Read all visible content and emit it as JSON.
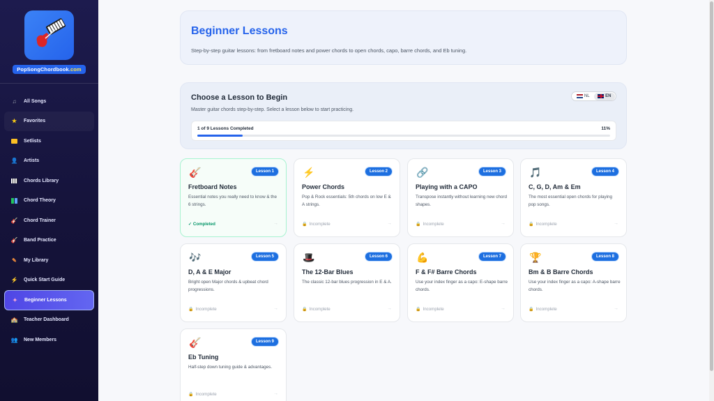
{
  "brand": {
    "name_part1": "PopSongChordbook",
    "name_part2": ".com"
  },
  "nav": [
    {
      "label": "All Songs",
      "icon": "music-note-icon"
    },
    {
      "label": "Favorites",
      "icon": "star-icon"
    },
    {
      "label": "Setlists",
      "icon": "folder-icon"
    },
    {
      "label": "Artists",
      "icon": "person-icon"
    },
    {
      "label": "Chords Library",
      "icon": "piano-icon"
    },
    {
      "label": "Chord Theory",
      "icon": "books-icon"
    },
    {
      "label": "Chord Trainer",
      "icon": "guitar-icon"
    },
    {
      "label": "Band Practice",
      "icon": "guitar-icon"
    },
    {
      "label": "My Library",
      "icon": "pencil-icon"
    },
    {
      "label": "Quick Start Guide",
      "icon": "lightning-icon"
    },
    {
      "label": "Beginner Lessons",
      "icon": "sparkle-icon"
    },
    {
      "label": "Teacher Dashboard",
      "icon": "school-icon"
    },
    {
      "label": "New Members",
      "icon": "people-icon"
    }
  ],
  "hero": {
    "title": "Beginner Lessons",
    "subtitle": "Step-by-step guitar lessons: from fretboard notes and power chords to open chords, capo, barre chords, and Eb tuning."
  },
  "choose": {
    "title": "Choose a Lesson to Begin",
    "subtitle": "Master guitar chords step-by-step. Select a lesson below to start practicing.",
    "lang_nl": "NL",
    "lang_en": "EN",
    "progress_label": "1 of 9 Lessons Completed",
    "progress_pct": "11%",
    "progress_value": 11
  },
  "lessons": [
    {
      "badge": "Lesson 1",
      "title": "Fretboard Notes",
      "desc": "Essential notes you really need to know & the 6 strings.",
      "status": "✓ Completed",
      "icon": "guitar-icon",
      "glyph": "🎸",
      "done": true
    },
    {
      "badge": "Lesson 2",
      "title": "Power Chords",
      "desc": "Pop & Rock essentials: 5th chords on low E & A strings.",
      "status": "Incomplete",
      "icon": "lightning-icon",
      "glyph": "⚡"
    },
    {
      "badge": "Lesson 3",
      "title": "Playing with a CAPO",
      "desc": "Transpose instantly without learning new chord shapes.",
      "status": "Incomplete",
      "icon": "link-icon",
      "glyph": "🔗"
    },
    {
      "badge": "Lesson 4",
      "title": "C, G, D, Am & Em",
      "desc": "The most essential open chords for playing pop songs.",
      "status": "Incomplete",
      "icon": "music-note-icon",
      "glyph": "🎵"
    },
    {
      "badge": "Lesson 5",
      "title": "D, A & E Major",
      "desc": "Bright open Major chords & upbeat chord progressions.",
      "status": "Incomplete",
      "icon": "music-notes-icon",
      "glyph": "🎶"
    },
    {
      "badge": "Lesson 6",
      "title": "The 12-Bar Blues",
      "desc": "The classic 12-bar blues progression in E & A.",
      "status": "Incomplete",
      "icon": "top-hat-icon",
      "glyph": "🎩"
    },
    {
      "badge": "Lesson 7",
      "title": "F & F# Barre Chords",
      "desc": "Use your index finger as a capo: E-shape barre chords.",
      "status": "Incomplete",
      "icon": "flexed-arm-icon",
      "glyph": "💪"
    },
    {
      "badge": "Lesson 8",
      "title": "Bm & B Barre Chords",
      "desc": "Use your index finger as a capo: A-shape barre chords.",
      "status": "Incomplete",
      "icon": "trophy-icon",
      "glyph": "🏆"
    },
    {
      "badge": "Lesson 9",
      "title": "Eb Tuning",
      "desc": "Half-step down tuning guide & advantages.",
      "status": "Incomplete",
      "icon": "guitar-icon",
      "glyph": "🎸"
    }
  ],
  "colors": {
    "accent": "#2563eb",
    "sidebar": "#1d1b4e",
    "active": "#4f46e5",
    "completed": "#059669"
  }
}
